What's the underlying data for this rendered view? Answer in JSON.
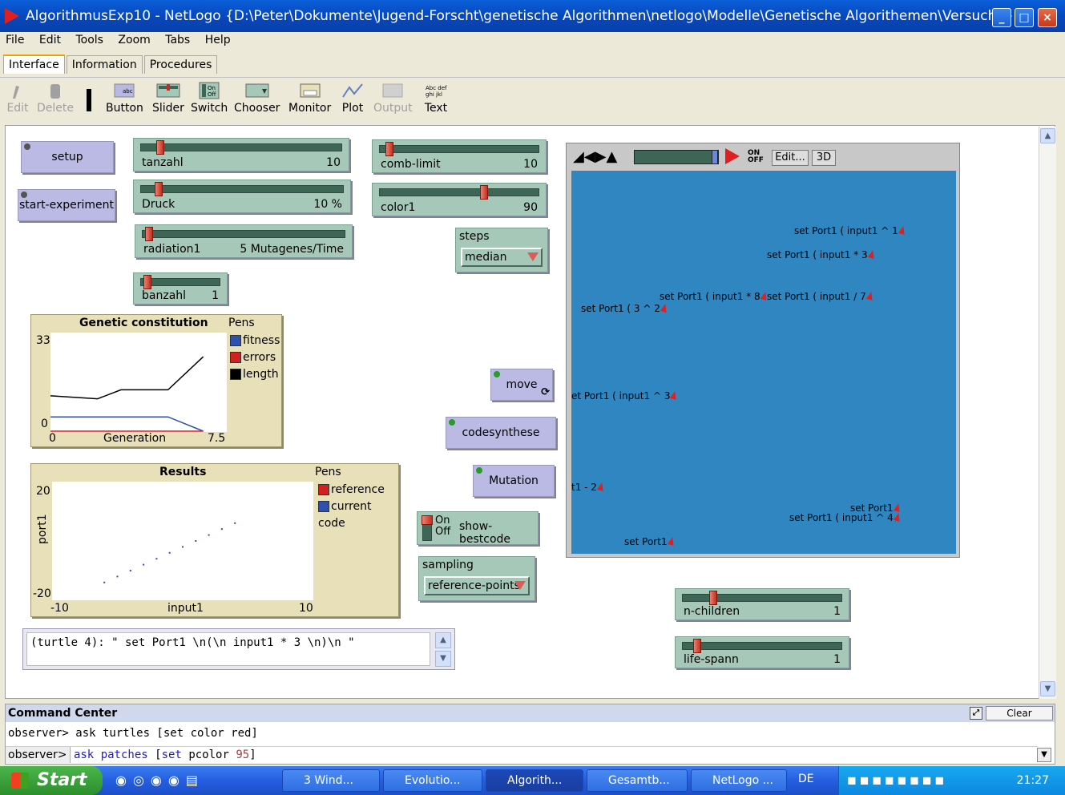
{
  "window": {
    "title": "AlgorithmusExp10 - NetLogo {D:\\Peter\\Dokumente\\Jugend-Forscht\\genetische Algorithmen\\netlogo\\Modelle\\Genetische Algorithemen\\Versuche}",
    "minimize": "_",
    "maximize": "□",
    "close": "×"
  },
  "menu": [
    "File",
    "Edit",
    "Tools",
    "Zoom",
    "Tabs",
    "Help"
  ],
  "tabs": [
    "Interface",
    "Information",
    "Procedures"
  ],
  "toolbar": {
    "edit": "Edit",
    "delete": "Delete",
    "button": "Button",
    "slider": "Slider",
    "switch": "Switch",
    "chooser": "Chooser",
    "monitor": "Monitor",
    "plot": "Plot",
    "output": "Output",
    "text": "Text"
  },
  "buttons": {
    "setup": "setup",
    "start_experiment": "start-experiment",
    "move": "move",
    "codesynthese": "codesynthese",
    "mutation": "Mutation"
  },
  "sliders": {
    "tanzahl": {
      "name": "tanzahl",
      "value": "10"
    },
    "druck": {
      "name": "Druck",
      "value": "10 %"
    },
    "radiation1": {
      "name": "radiation1",
      "value": "5 Mutagenes/Time"
    },
    "banzahl": {
      "name": "banzahl",
      "value": "1"
    },
    "comb_limit": {
      "name": "comb-limit",
      "value": "10"
    },
    "color1": {
      "name": "color1",
      "value": "90"
    },
    "n_children": {
      "name": "n-children",
      "value": "1"
    },
    "life_spann": {
      "name": "life-spann",
      "value": "1"
    }
  },
  "choosers": {
    "steps": {
      "name": "steps",
      "value": "median"
    },
    "sampling": {
      "name": "sampling",
      "value": "reference-points"
    }
  },
  "switch": {
    "name": "show-bestcode",
    "on": "On",
    "off": "Off"
  },
  "plot1": {
    "title": "Genetic constitution",
    "ymax": "33",
    "ymin": "0",
    "xmin": "0",
    "xmax": "7.5",
    "xlabel": "Generation",
    "pens_label": "Pens",
    "pens": [
      {
        "name": "fitness",
        "color": "#3050b0"
      },
      {
        "name": "errors",
        "color": "#d02020"
      },
      {
        "name": "length",
        "color": "#000000"
      }
    ]
  },
  "plot2": {
    "title": "Results",
    "ymax": "20",
    "ymin": "-20",
    "xmin": "-10",
    "xmax": "10",
    "xlabel": "input1",
    "ylabel": "port1",
    "pens_label": "Pens",
    "pens": [
      {
        "name": "reference",
        "color": "#d02020"
      },
      {
        "name": "current code",
        "color": "#3050b0"
      }
    ]
  },
  "chart_data": [
    {
      "type": "line",
      "title": "Genetic constitution",
      "xlabel": "Generation",
      "ylabel": "",
      "xlim": [
        0,
        7.5
      ],
      "ylim": [
        0,
        33
      ],
      "series": [
        {
          "name": "length",
          "x": [
            0,
            2,
            3,
            5,
            6.5
          ],
          "y": [
            12,
            11,
            14,
            14,
            25
          ]
        },
        {
          "name": "fitness",
          "x": [
            0,
            2,
            5,
            6.5
          ],
          "y": [
            5,
            5,
            5,
            0
          ]
        },
        {
          "name": "errors",
          "x": [
            0,
            6.5
          ],
          "y": [
            0,
            0
          ]
        }
      ]
    },
    {
      "type": "scatter",
      "title": "Results",
      "xlabel": "input1",
      "ylabel": "port1",
      "xlim": [
        -10,
        10
      ],
      "ylim": [
        -20,
        20
      ],
      "series": [
        {
          "name": "current code",
          "x": [
            -6,
            -5,
            -4,
            -3,
            -2,
            -1,
            0,
            1,
            2,
            3,
            4
          ],
          "y": [
            -14,
            -12,
            -10,
            -8,
            -6,
            -4,
            -2,
            0,
            2,
            4,
            6
          ]
        }
      ]
    }
  ],
  "view": {
    "edit": "Edit...",
    "three_d": "3D",
    "labels": [
      "set Port1 ( input1 ^ 1",
      "set Port1 ( input1 * 3",
      "set Port1 ( input1 * 8",
      "set Port1 ( input1 / 7",
      "set Port1 ( 3 ^ 2",
      "et Port1 ( input1 ^ 3",
      "t1 - 2",
      "set Port1",
      "set Port1 ( input1 ^ 4",
      "set Port1"
    ]
  },
  "output": "(turtle 4): \" set Port1 \\n(\\n input1 * 3 \\n)\\n \"",
  "command_center": {
    "title": "Command Center",
    "clear": "Clear",
    "history": "observer> ask turtles [set color red]",
    "prompt": "observer>",
    "input_kw1": "ask",
    "input_txt1": "patches",
    "input_br": "[",
    "input_kw2": "set",
    "input_txt2": "pcolor",
    "input_num": "95",
    "input_end": "]"
  },
  "taskbar": {
    "start": "Start",
    "tasks": [
      "3 Wind...",
      "Evolutio...",
      "Algorith...",
      "Gesamtb...",
      "NetLogo ..."
    ],
    "lang": "DE",
    "clock": "21:27"
  }
}
